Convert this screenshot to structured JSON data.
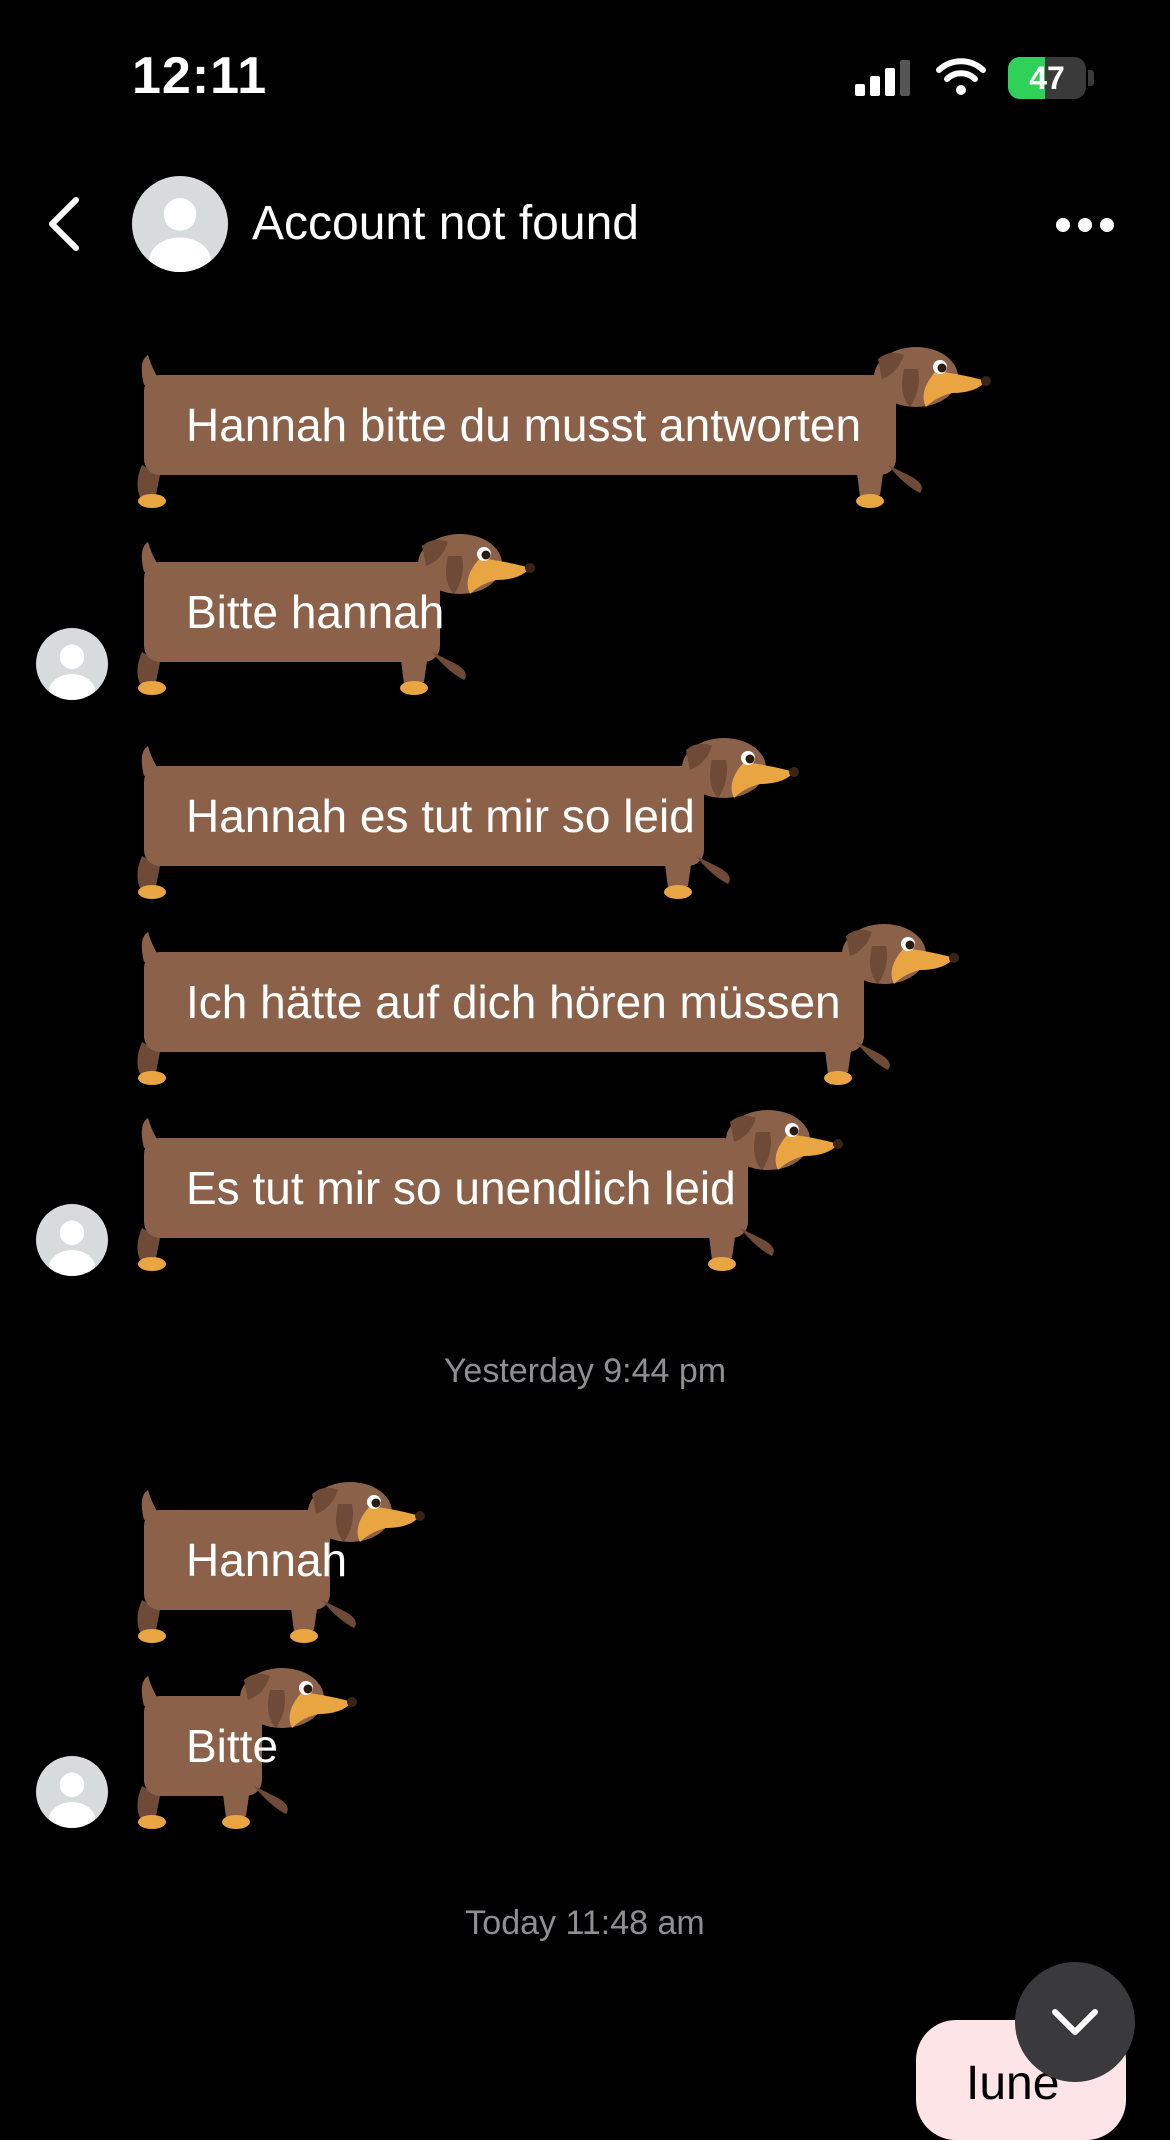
{
  "status_bar": {
    "time": "12:11",
    "battery_level": "47",
    "signal_icon": "cellular-signal-icon",
    "wifi_icon": "wifi-icon",
    "battery_icon": "battery-charging-icon"
  },
  "header": {
    "title": "Account not found",
    "back_icon": "chevron-left-icon",
    "more_icon": "ellipsis-icon"
  },
  "messages": [
    {
      "text": "Hannah bitte du musst antworten"
    },
    {
      "text": "Bitte hannah"
    },
    {
      "text": "Hannah es tut mir so leid"
    },
    {
      "text": "Ich hätte auf dich hören müssen"
    },
    {
      "text": "Es tut mir so unendlich leid"
    },
    {
      "text": "Hannah"
    },
    {
      "text": "Bitte"
    }
  ],
  "timestamps": [
    "Yesterday 9:44 pm",
    "Today 11:48 am"
  ],
  "outgoing_peek": {
    "text": "Iune"
  },
  "colors": {
    "background": "#000000",
    "bubble": "#8b6249",
    "dog_accent": "#e8a541",
    "outgoing_bubble": "#fde4e6",
    "timestamp": "#8e8e93",
    "battery": "#30d158"
  }
}
